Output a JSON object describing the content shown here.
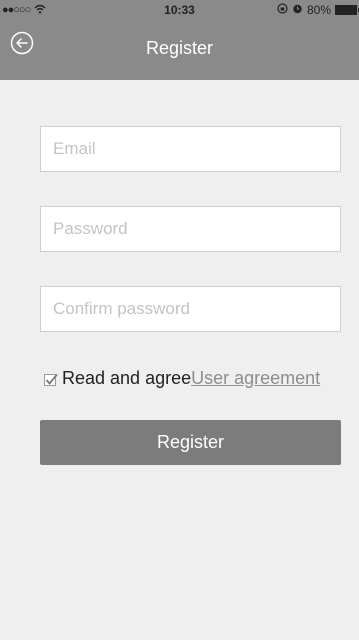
{
  "status_bar": {
    "signal": "●●○○○",
    "time": "10:33",
    "battery": "80%",
    "icons": [
      "wifi-icon",
      "orientation-lock-icon",
      "alarm-icon",
      "battery-icon"
    ]
  },
  "nav": {
    "title": "Register",
    "back_icon": "back-arrow-icon"
  },
  "form": {
    "email_placeholder": "Email",
    "email_value": "",
    "password_placeholder": "Password",
    "password_value": "",
    "confirm_placeholder": "Confirm password",
    "confirm_value": "",
    "agree_checked": true,
    "agree_text": "Read and agree",
    "agree_link": "User agreement",
    "submit_label": "Register"
  },
  "colors": {
    "header_bg": "#8a8a8a",
    "page_bg": "#efefef",
    "button_bg": "#7c7c7c",
    "link": "#8d8d8d"
  }
}
